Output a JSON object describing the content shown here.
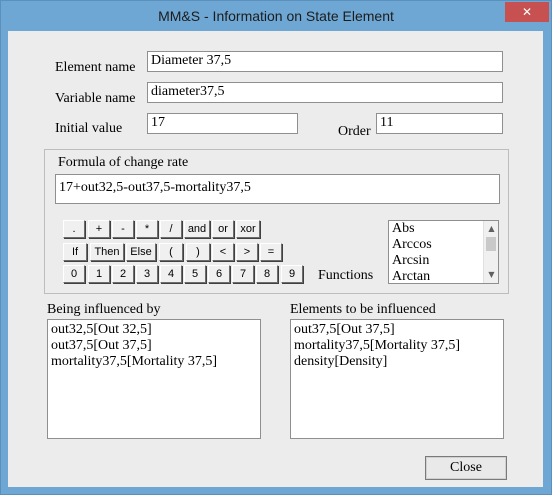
{
  "window": {
    "title": "MM&S - Information on State Element",
    "close_glyph": "✕"
  },
  "fields": {
    "element_name": {
      "label": "Element name",
      "value": "Diameter 37,5"
    },
    "variable_name": {
      "label": "Variable name",
      "value": "diameter37,5"
    },
    "initial_value": {
      "label": "Initial value",
      "value": "17"
    },
    "order": {
      "label": "Order",
      "value": "11"
    }
  },
  "formula": {
    "group_label": "Formula of change rate",
    "value": "17+out32,5-out37,5-mortality37,5"
  },
  "calculator": {
    "row1": [
      ".",
      "+",
      "-",
      "*",
      "/",
      "and",
      "or",
      "xor"
    ],
    "row2": [
      "If",
      "Then",
      "Else",
      "(",
      ")",
      "<",
      ">",
      "="
    ],
    "row3": [
      "0",
      "1",
      "2",
      "3",
      "4",
      "5",
      "6",
      "7",
      "8",
      "9"
    ]
  },
  "functions": {
    "label": "Functions",
    "items": [
      "Abs",
      "Arccos",
      "Arcsin",
      "Arctan"
    ],
    "scroll_icon": "scroll-arrows"
  },
  "being_influenced_by": {
    "label": "Being influenced by",
    "items": [
      "out32,5[Out 32,5]",
      "out37,5[Out 37,5]",
      "mortality37,5[Mortality 37,5]"
    ]
  },
  "elements_to_be_influenced": {
    "label": "Elements to be influenced",
    "items": [
      "out37,5[Out 37,5]",
      "mortality37,5[Mortality 37,5]",
      "density[Density]"
    ]
  },
  "buttons": {
    "close": "Close"
  },
  "colors": {
    "title_bar": "#6ea7d4",
    "close_button": "#c75050",
    "dialog_background": "#ececec"
  }
}
